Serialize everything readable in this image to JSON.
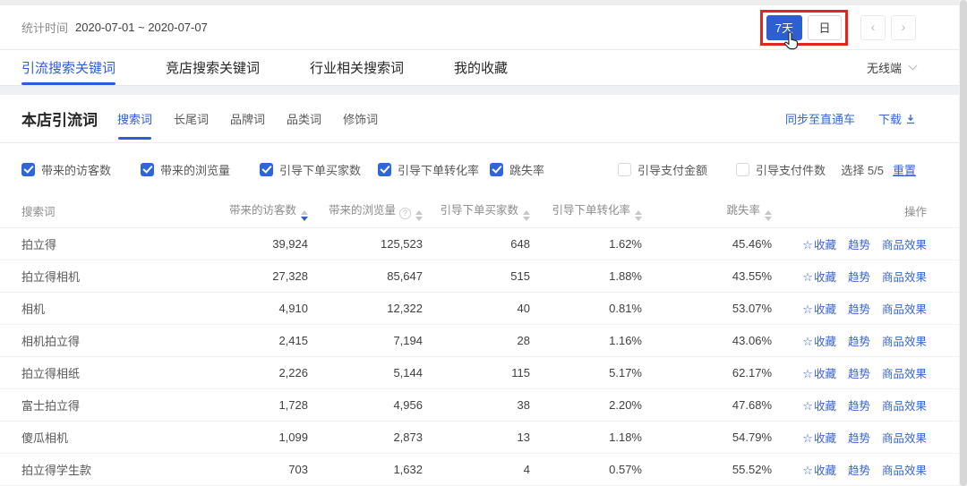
{
  "colors": {
    "accent_blue": "#2e5ecf",
    "link_blue": "#3a66cc",
    "annotation_red": "#e7231d"
  },
  "icons": {
    "star": "☆",
    "prev": "‹",
    "next": "›"
  },
  "date_bar": {
    "label": "统计时间",
    "range": "2020-07-01 ~ 2020-07-07"
  },
  "period_switch": {
    "buttons": [
      {
        "label": "7天",
        "active": true
      },
      {
        "label": "日",
        "active": false
      }
    ]
  },
  "main_tabs": [
    {
      "label": "引流搜索关键词",
      "active": true
    },
    {
      "label": "竞店搜索关键词",
      "active": false
    },
    {
      "label": "行业相关搜索词",
      "active": false
    },
    {
      "label": "我的收藏",
      "active": false
    }
  ],
  "terminal_selector": {
    "label": "无线端"
  },
  "section": {
    "title": "本店引流词",
    "subtabs": [
      {
        "label": "搜索词",
        "active": true
      },
      {
        "label": "长尾词",
        "active": false
      },
      {
        "label": "品牌词",
        "active": false
      },
      {
        "label": "品类词",
        "active": false
      },
      {
        "label": "修饰词",
        "active": false
      }
    ],
    "sync_link": "同步至直通车",
    "download_link": "下载"
  },
  "metric_filters": {
    "items": [
      {
        "label": "带来的访客数",
        "checked": true
      },
      {
        "label": "带来的浏览量",
        "checked": true
      },
      {
        "label": "引导下单买家数",
        "checked": true
      },
      {
        "label": "引导下单转化率",
        "checked": true
      },
      {
        "label": "跳失率",
        "checked": true
      },
      {
        "label": "引导支付金额",
        "checked": false
      },
      {
        "label": "引导支付件数",
        "checked": false
      }
    ],
    "selection_text": "选择 5/5",
    "reset_label": "重置"
  },
  "table": {
    "columns": [
      {
        "label": "搜索词",
        "align": "left"
      },
      {
        "label": "带来的访客数",
        "sortable": true,
        "sort_desc_active": true
      },
      {
        "label": "带来的浏览量",
        "sortable": true,
        "info": true
      },
      {
        "label": "引导下单买家数",
        "sortable": true
      },
      {
        "label": "引导下单转化率",
        "sortable": true
      },
      {
        "label": "跳失率",
        "sortable": true
      },
      {
        "label": "操作",
        "align": "right"
      }
    ],
    "actions": {
      "favorite": "收藏",
      "trend": "趋势",
      "product_effect": "商品效果"
    },
    "rows": [
      {
        "keyword": "拍立得",
        "visitors": "39,924",
        "views": "125,523",
        "buyers": "648",
        "conversion": "1.62%",
        "bounce": "45.46%"
      },
      {
        "keyword": "拍立得相机",
        "visitors": "27,328",
        "views": "85,647",
        "buyers": "515",
        "conversion": "1.88%",
        "bounce": "43.55%"
      },
      {
        "keyword": "相机",
        "visitors": "4,910",
        "views": "12,322",
        "buyers": "40",
        "conversion": "0.81%",
        "bounce": "53.07%"
      },
      {
        "keyword": "相机拍立得",
        "visitors": "2,415",
        "views": "7,194",
        "buyers": "28",
        "conversion": "1.16%",
        "bounce": "43.06%"
      },
      {
        "keyword": "拍立得相纸",
        "visitors": "2,226",
        "views": "5,144",
        "buyers": "115",
        "conversion": "5.17%",
        "bounce": "62.17%"
      },
      {
        "keyword": "富士拍立得",
        "visitors": "1,728",
        "views": "4,956",
        "buyers": "38",
        "conversion": "2.20%",
        "bounce": "47.68%"
      },
      {
        "keyword": "傻瓜相机",
        "visitors": "1,099",
        "views": "2,873",
        "buyers": "13",
        "conversion": "1.18%",
        "bounce": "54.79%"
      },
      {
        "keyword": "拍立得学生款",
        "visitors": "703",
        "views": "1,632",
        "buyers": "4",
        "conversion": "0.57%",
        "bounce": "55.52%"
      }
    ]
  }
}
